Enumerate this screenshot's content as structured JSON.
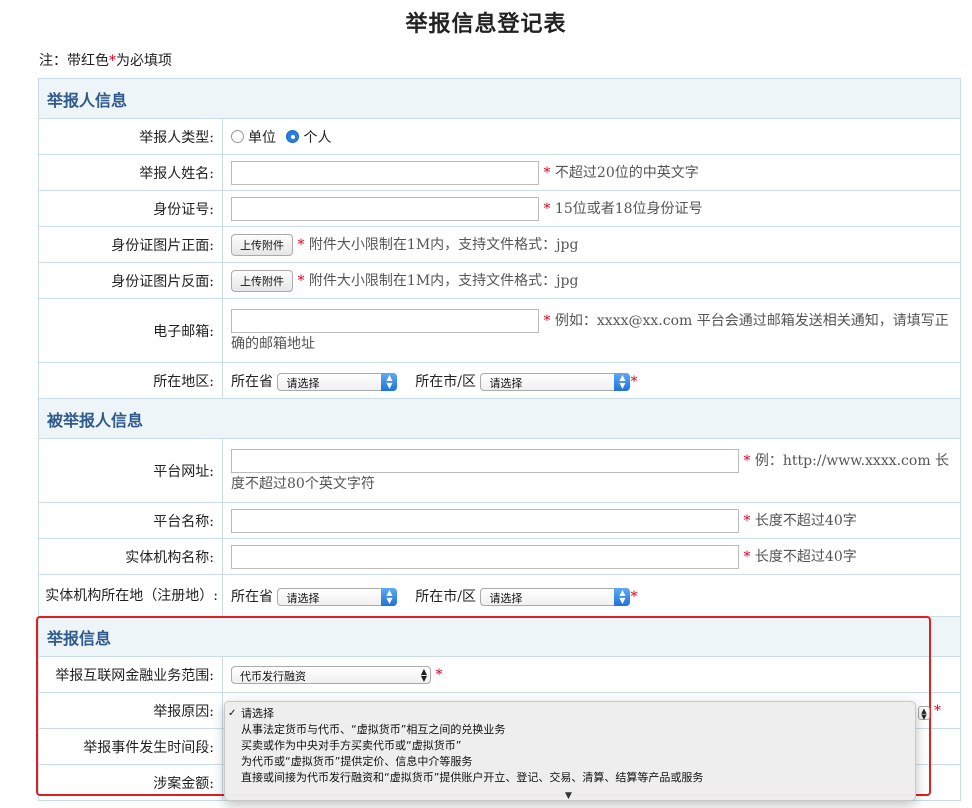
{
  "title": "举报信息登记表",
  "note": {
    "prefix": "注：带红色",
    "star": "*",
    "suffix": "为必填项"
  },
  "star": "*",
  "sections": {
    "reporter": "举报人信息",
    "reported": "被举报人信息",
    "report": "举报信息"
  },
  "reporter": {
    "type_label": "举报人类型:",
    "type_options": [
      "单位",
      "个人"
    ],
    "type_selected": "个人",
    "name_label": "举报人姓名:",
    "name_hint": "不超过20位的中英文字",
    "id_label": "身份证号:",
    "id_hint": "15位或者18位身份证号",
    "id_front_label": "身份证图片正面:",
    "id_back_label": "身份证图片反面:",
    "upload_button": "上传附件",
    "upload_hint": "附件大小限制在1M内，支持文件格式：jpg",
    "email_label": "电子邮箱:",
    "email_hint": "例如：xxxx@xx.com 平台会通过邮箱发送相关通知，请填写正确的邮箱地址",
    "region_label": "所在地区:",
    "province_label": "所在省",
    "city_label": "所在市/区",
    "select_placeholder": "请选择"
  },
  "reported": {
    "url_label": "平台网址:",
    "url_hint": "例：http://www.xxxx.com 长度不超过80个英文字符",
    "name_label": "平台名称:",
    "name_hint": "长度不超过40字",
    "entity_label": "实体机构名称:",
    "entity_hint": "长度不超过40字",
    "location_label": "实体机构所在地（注册地）:",
    "province_label": "所在省",
    "city_label": "所在市/区",
    "select_placeholder": "请选择"
  },
  "report": {
    "scope_label": "举报互联网金融业务范围:",
    "scope_value": "代币发行融资",
    "reason_label": "举报原因:",
    "time_label": "举报事件发生时间段:",
    "amount_label": "涉案金额:"
  },
  "reason_dropdown": {
    "selected_index": 0,
    "options": [
      "请选择",
      "从事法定货币与代币、“虚拟货币”相互之间的兑换业务",
      "买卖或作为中央对手方买卖代币或“虚拟货币”",
      "为代币或“虚拟货币”提供定价、信息中介等服务",
      "直接或间接为代币发行融资和“虚拟货币”提供账户开立、登记、交易、清算、结算等产品或服务"
    ]
  },
  "colors": {
    "section_text": "#2f5a8b",
    "section_bg": "#eef5f8",
    "border": "#c9dde6",
    "required": "#d9001b",
    "highlight_frame": "#e02020",
    "radio_selected": "#2b7de1"
  },
  "icons": {
    "radio_on": "radio-selected-icon",
    "radio_off": "radio-unselected-icon",
    "select_arrows": "chevron-up-down-icon",
    "check": "checkmark-icon",
    "scroll": "scroll-down-arrow-icon"
  }
}
